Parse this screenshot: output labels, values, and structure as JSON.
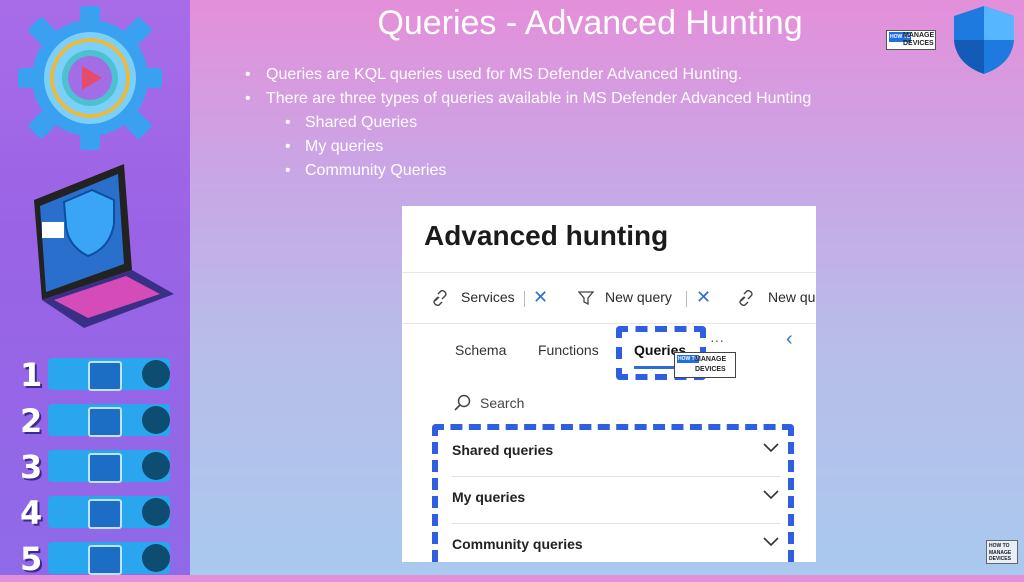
{
  "slide": {
    "title": "Queries - Advanced Hunting",
    "bullets": [
      {
        "text": "Queries are KQL queries used for MS Defender Advanced Hunting.",
        "level": 1
      },
      {
        "text": "There are three types of queries available in MS Defender Advanced Hunting",
        "level": 1
      },
      {
        "text": "Shared Queries",
        "level": 2
      },
      {
        "text": "My queries",
        "level": 2
      },
      {
        "text": "Community Queries",
        "level": 2
      }
    ]
  },
  "logos": {
    "brand_top": {
      "how": "HOW TO",
      "line1": "MANAGE",
      "line2": "DEVICES"
    },
    "brand_mini": {
      "how": "HOW TO",
      "line1": "MANAGE",
      "line2": "DEVICES"
    },
    "watermark": {
      "how": "HOW TO",
      "line1": "MANAGE",
      "line2": "DEVICES"
    }
  },
  "sidebar": {
    "steps": [
      "1",
      "2",
      "3",
      "4",
      "5"
    ]
  },
  "panel": {
    "title": "Advanced hunting",
    "toolbar": [
      {
        "label": "Services",
        "icon": "link-icon"
      },
      {
        "label": "New query",
        "icon": "filter-icon"
      },
      {
        "label": "New qu",
        "icon": "link-icon"
      }
    ],
    "tabs": [
      {
        "label": "Schema",
        "active": false
      },
      {
        "label": "Functions",
        "active": false
      },
      {
        "label": "Queries",
        "active": true
      }
    ],
    "more": "···",
    "search_label": "Search",
    "query_groups": [
      {
        "label": "Shared queries"
      },
      {
        "label": "My queries"
      },
      {
        "label": "Community queries"
      }
    ]
  },
  "colors": {
    "accent_blue": "#2f5ee0",
    "sidebar_purple": "#9a63e6",
    "step_bar": "#2aa6ef"
  }
}
